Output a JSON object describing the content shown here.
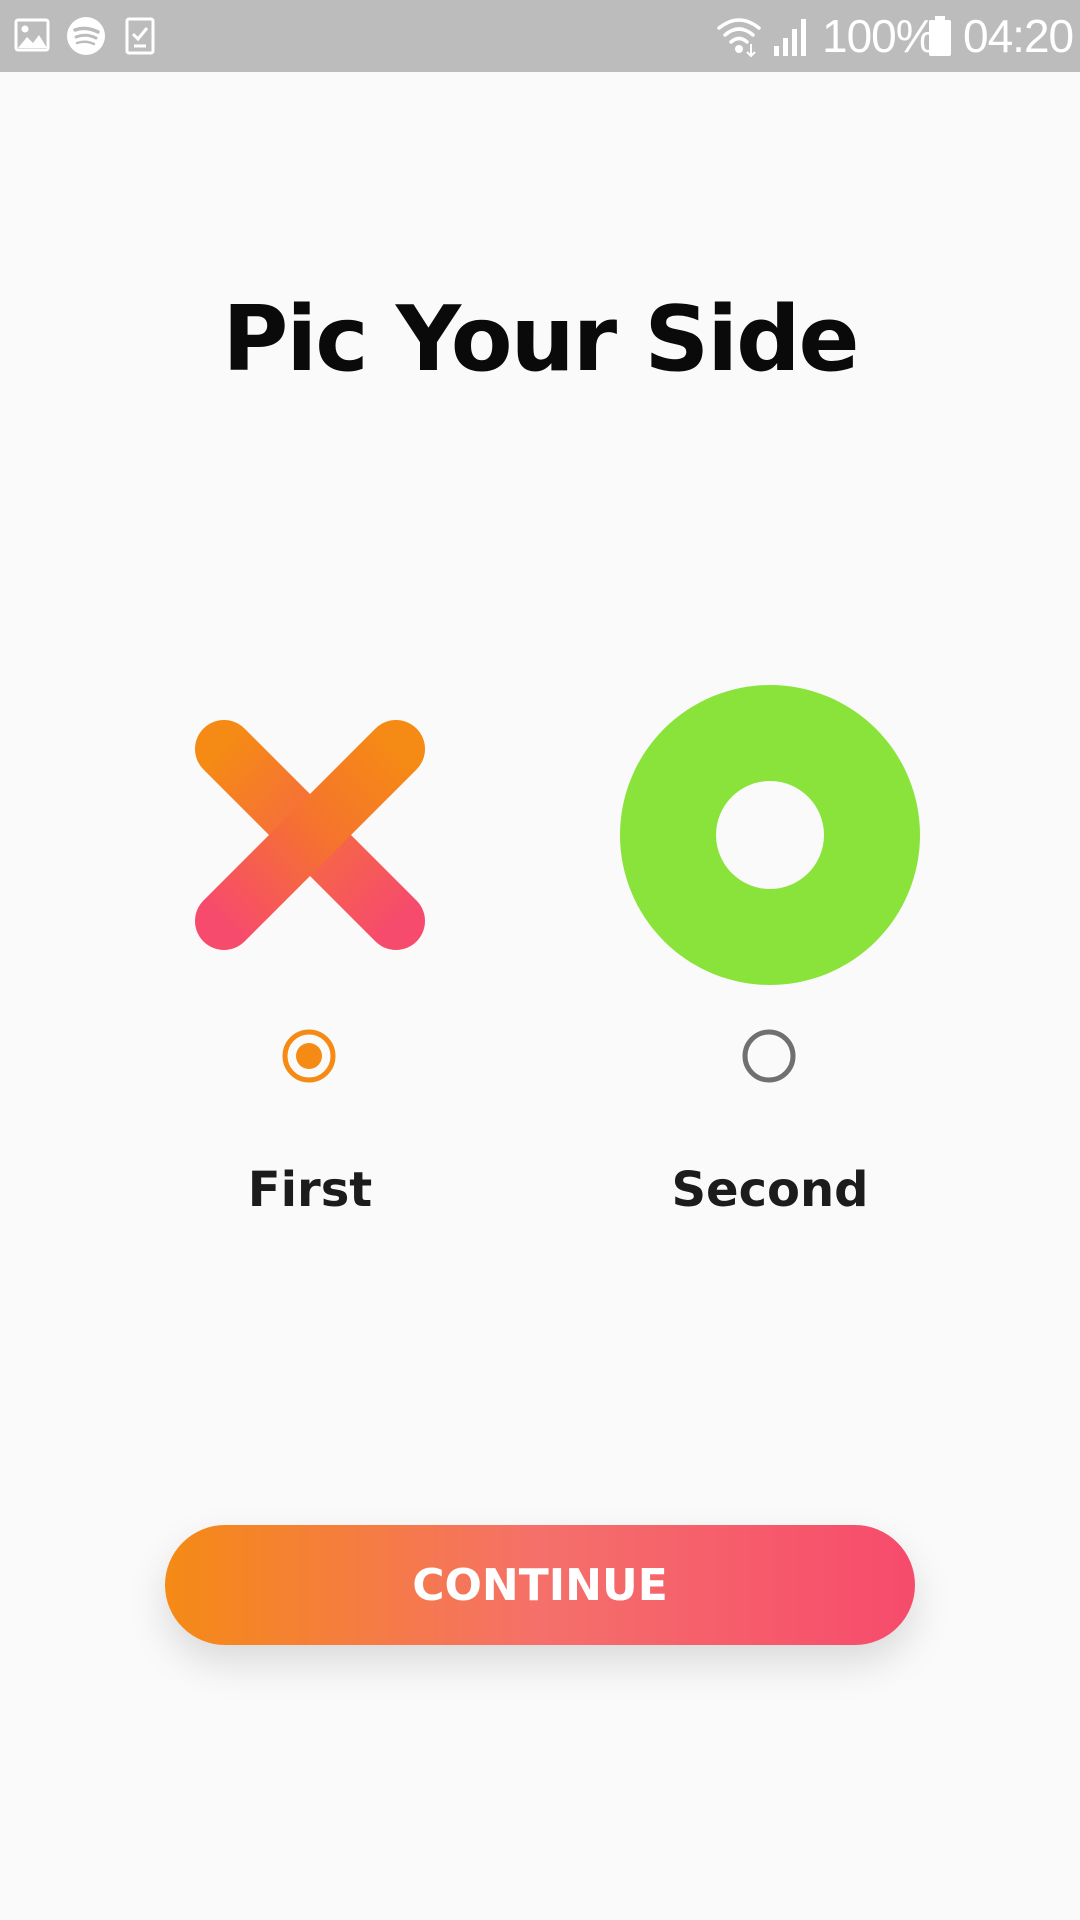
{
  "status_bar": {
    "left_icons": [
      "gallery-icon",
      "spotify-icon",
      "task-icon"
    ],
    "right_icons": [
      "wifi-icon",
      "signal-icon",
      "battery-icon"
    ],
    "battery_text": "100%",
    "time": "04:20"
  },
  "title": "Pic Your Side",
  "choices": [
    {
      "label": "First",
      "icon": "x-mark-icon",
      "selected": true
    },
    {
      "label": "Second",
      "icon": "o-ring-icon",
      "selected": false
    }
  ],
  "continue_label": "CONTINUE",
  "colors": {
    "accent_orange": "#f58a15",
    "accent_pink": "#f64b6c",
    "o_green": "#8ae33a",
    "radio_unselected": "#707070",
    "status_bar": "#bcbcbc",
    "background": "#fafafa"
  }
}
